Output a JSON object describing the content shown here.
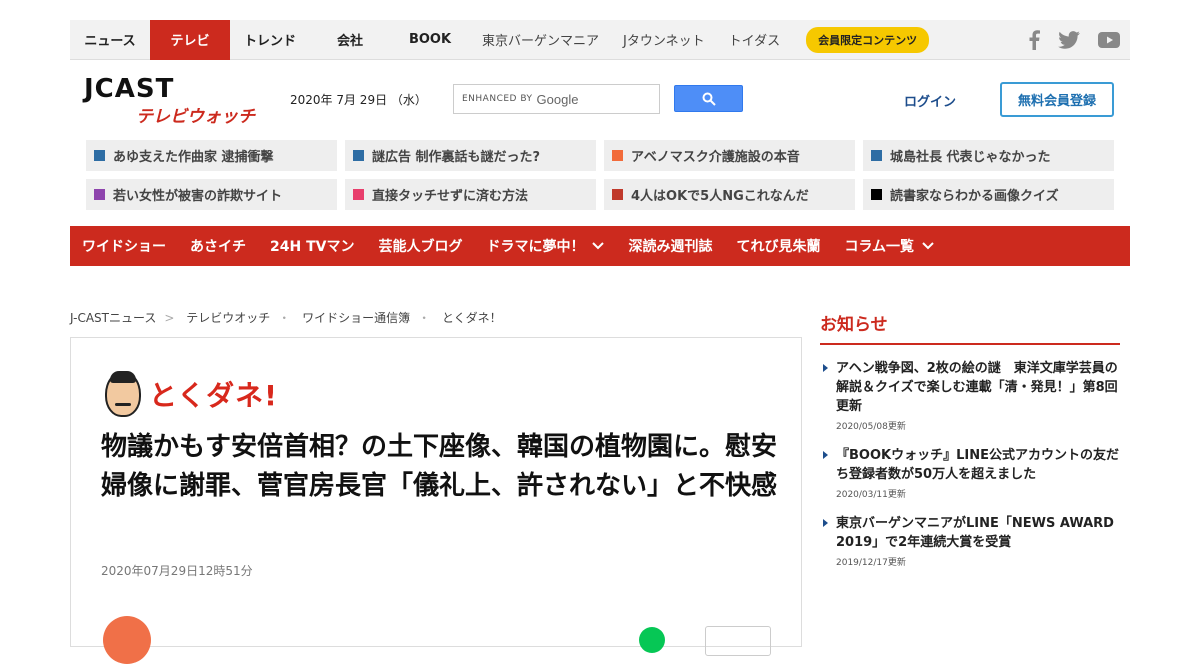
{
  "topnav": {
    "tabs": [
      {
        "label": "ニュース",
        "active": false
      },
      {
        "label": "テレビ",
        "active": true
      },
      {
        "label": "トレンド",
        "active": false
      },
      {
        "label": "会社",
        "active": false
      },
      {
        "label": "BOOK",
        "active": false
      }
    ],
    "subs": [
      "東京バーゲンマニア",
      "Jタウンネット",
      "トイダス"
    ],
    "member_label": "会員限定コンテンツ",
    "social": [
      "facebook-icon",
      "twitter-icon",
      "youtube-icon"
    ]
  },
  "header": {
    "logo_top": "JCAST",
    "logo_bottom": "テレビウォッチ",
    "date": "2020年 7月 29日 （水）",
    "search_enhanced": "ENHANCED BY",
    "search_google": "Google",
    "login": "ログイン",
    "register": "無料会員登録"
  },
  "trending": [
    {
      "label": "あゆ支えた作曲家 逮捕衝撃",
      "color": "#2e6da4"
    },
    {
      "label": "謎広告 制作裏話も謎だった?",
      "color": "#2e6da4"
    },
    {
      "label": "アベノマスク介護施設の本音",
      "color": "#f26b3a"
    },
    {
      "label": "城島社長 代表じゃなかった",
      "color": "#2e6da4"
    },
    {
      "label": "若い女性が被害の詐欺サイト",
      "color": "#8e44ad"
    },
    {
      "label": "直接タッチせずに済む方法",
      "color": "#e83e6c"
    },
    {
      "label": "4人はOKで5人NGこれなんだ",
      "color": "#c0392b"
    },
    {
      "label": "読書家ならわかる画像クイズ",
      "color": "#000000"
    }
  ],
  "rednav": [
    {
      "label": "ワイドショー",
      "dropdown": false
    },
    {
      "label": "あさイチ",
      "dropdown": false
    },
    {
      "label": "24H TVマン",
      "dropdown": false
    },
    {
      "label": "芸能人ブログ",
      "dropdown": false
    },
    {
      "label": "ドラマに夢中！",
      "dropdown": true
    },
    {
      "label": "深読み週刊誌",
      "dropdown": false
    },
    {
      "label": "てれび見朱蘭",
      "dropdown": false
    },
    {
      "label": "コラム一覧",
      "dropdown": true
    }
  ],
  "breadcrumb": [
    "J-CASTニュース",
    "テレビウオッチ",
    "ワイドショー通信簿",
    "とくダネ！"
  ],
  "article": {
    "show": "とくダネ!",
    "title": "物議かもす安倍首相？の土下座像、韓国の植物園に。慰安婦像に謝罪、菅官房長官「儀礼上、許されない」と不快感",
    "date": "2020年07月29日12時51分"
  },
  "sidebar": {
    "heading": "お知らせ",
    "items": [
      {
        "title": "アヘン戦争図、2枚の絵の謎　東洋文庫学芸員の解説＆クイズで楽しむ連載「清・発見！」第8回更新",
        "date": "2020/05/08更新"
      },
      {
        "title": "『BOOKウォッチ』LINE公式アカウントの友だち登録者数が50万人を超えました",
        "date": "2020/03/11更新"
      },
      {
        "title": "東京バーゲンマニアがLINE「NEWS AWARD 2019」で2年連続大賞を受賞",
        "date": "2019/12/17更新"
      }
    ]
  }
}
